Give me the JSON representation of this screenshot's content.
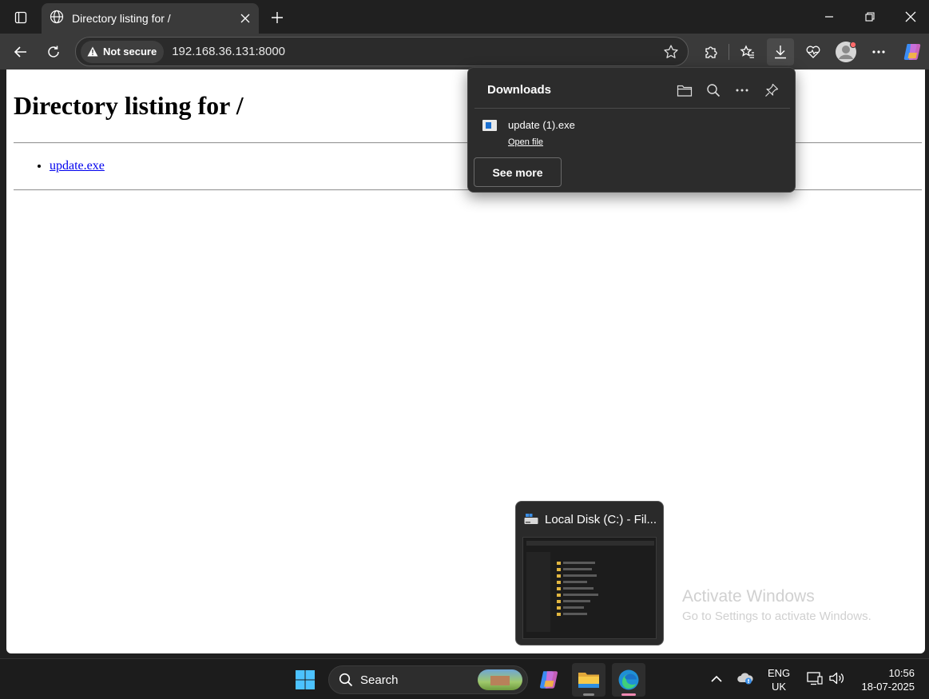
{
  "browser": {
    "tab_title": "Directory listing for /",
    "not_secure_label": "Not secure",
    "url": "192.168.36.131:8000"
  },
  "page": {
    "heading": "Directory listing for /",
    "files": [
      "update.exe"
    ]
  },
  "downloads": {
    "title": "Downloads",
    "items": [
      {
        "name": "update (1).exe",
        "action": "Open file"
      }
    ],
    "see_more_label": "See more"
  },
  "taskbar_preview": {
    "title": "Local Disk (C:) - Fil..."
  },
  "watermark": {
    "line1": "Activate Windows",
    "line2": "Go to Settings to activate Windows."
  },
  "taskbar": {
    "search_label": "Search",
    "language": "ENG",
    "region": "UK",
    "time": "10:56",
    "date": "18-07-2025"
  },
  "colors": {
    "link": "#0000ee",
    "chrome_dark": "#202020",
    "toolbar": "#3a3a3a",
    "edge_indicator": "#f28ab3"
  }
}
